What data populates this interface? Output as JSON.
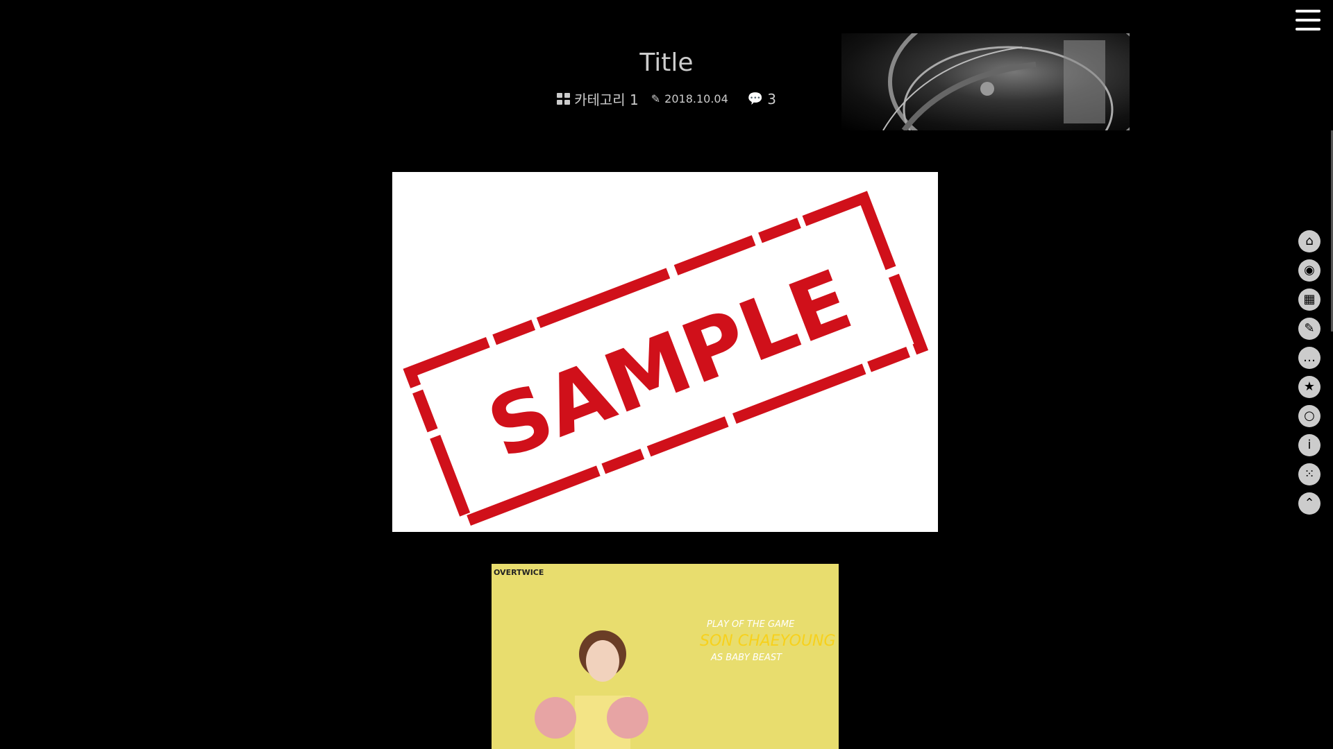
{
  "header": {
    "title": "Title",
    "category": "카테고리 1",
    "date": "2018.10.04",
    "comment_count": "3"
  },
  "icons": {
    "menu": "hamburger-icon",
    "category": "grid-icon",
    "date": "edit-icon",
    "comments": "comments-icon"
  },
  "images": {
    "sample_text": "SAMPLE",
    "poster_logo": "OVERTWICE",
    "poster_line1": "PLAY OF THE GAME",
    "poster_line2": "SON CHAEYOUNG",
    "poster_line3": "AS BABY BEAST"
  },
  "rail": [
    {
      "name": "home-icon",
      "glyph": "⌂"
    },
    {
      "name": "camera-icon",
      "glyph": "◉"
    },
    {
      "name": "calendar-icon",
      "glyph": "▦"
    },
    {
      "name": "checklist-icon",
      "glyph": "✎"
    },
    {
      "name": "chat-icon",
      "glyph": "…"
    },
    {
      "name": "bookmark-icon",
      "glyph": "★"
    },
    {
      "name": "search-icon",
      "glyph": "○"
    },
    {
      "name": "info-icon",
      "glyph": "i"
    },
    {
      "name": "dice-icon",
      "glyph": "⁙"
    },
    {
      "name": "scroll-top-icon",
      "glyph": "⌃"
    }
  ],
  "colors": {
    "background": "#000000",
    "stamp_red": "#d0101a",
    "poster_yellow": "#e8dd6e",
    "poster_name": "#f7d11c"
  }
}
